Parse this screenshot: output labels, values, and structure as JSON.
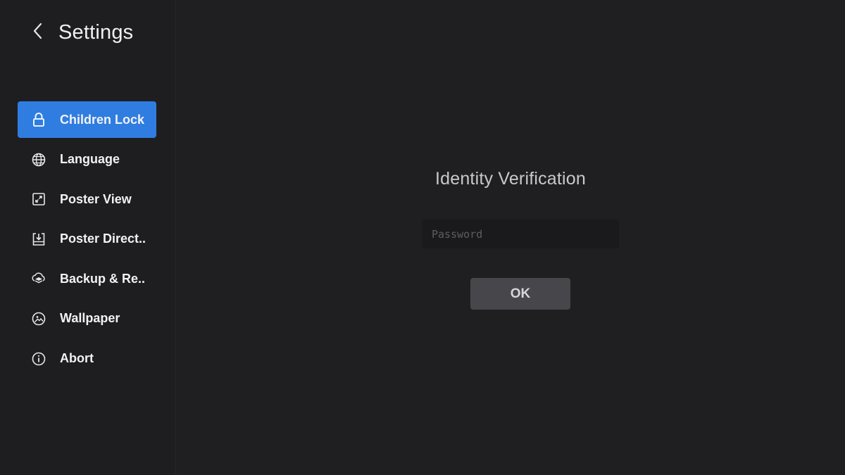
{
  "header": {
    "back_icon": "chevron-left-icon",
    "title": "Settings"
  },
  "sidebar": {
    "items": [
      {
        "label": "Children Lock",
        "icon": "lock-icon",
        "active": true
      },
      {
        "label": "Language",
        "icon": "globe-icon",
        "active": false
      },
      {
        "label": "Poster View",
        "icon": "expand-icon",
        "active": false
      },
      {
        "label": "Poster Direct..",
        "icon": "download-tray-icon",
        "active": false
      },
      {
        "label": "Backup & Re..",
        "icon": "cloud-layers-icon",
        "active": false
      },
      {
        "label": "Wallpaper",
        "icon": "image-icon",
        "active": false
      },
      {
        "label": "Abort",
        "icon": "info-icon",
        "active": false
      }
    ]
  },
  "dialog": {
    "title": "Identity Verification",
    "password_placeholder": "Password",
    "password_value": "",
    "ok_label": "OK"
  },
  "colors": {
    "background": "#1f1f21",
    "accent": "#2f7de1",
    "button": "#47474b"
  }
}
